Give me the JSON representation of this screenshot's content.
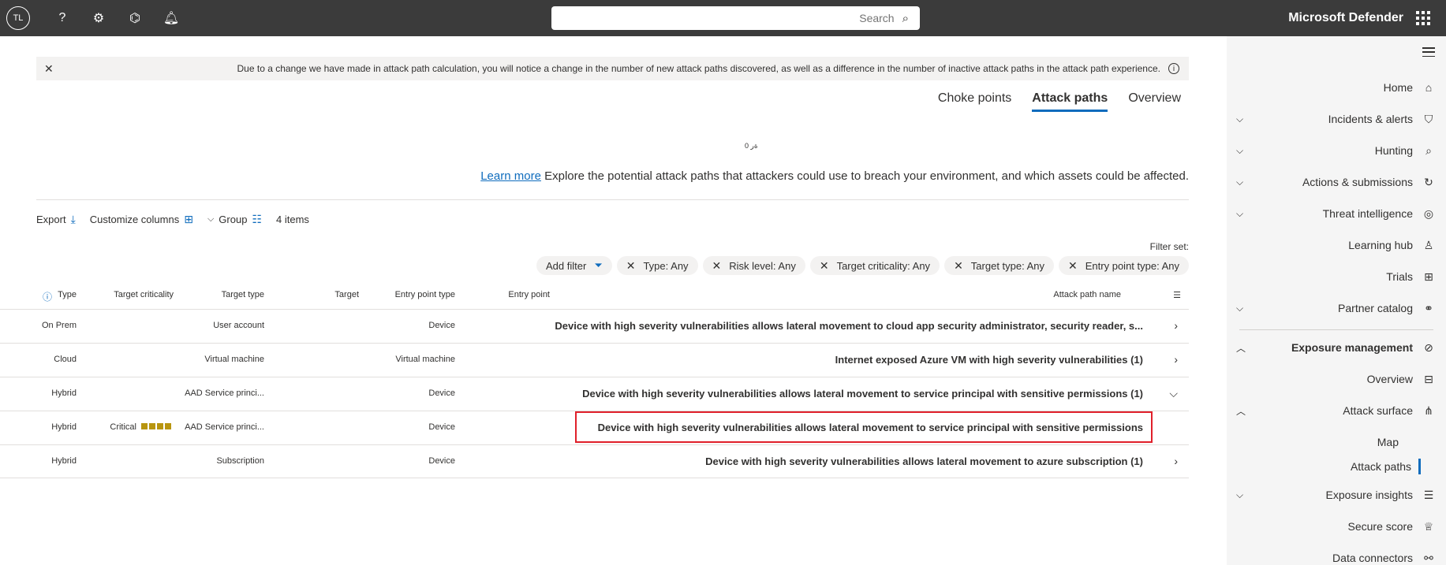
{
  "app": {
    "title": "Microsoft Defender"
  },
  "search": {
    "placeholder": "Search"
  },
  "user": {
    "initials": "TL"
  },
  "banner": {
    "text": "Due to a change we have made in attack path calculation, you will notice a change in the number of new attack paths discovered, as well as a difference in the number of inactive attack paths in the attack path experience."
  },
  "tabs": [
    "Overview",
    "Attack paths",
    "Choke points"
  ],
  "active_tab": "Attack paths",
  "tiny_label": "0 ﻿ﺓﺭ",
  "description": {
    "text": "Explore the potential attack paths that attackers could use to breach your environment, and which assets could be affected.",
    "link": "Learn more"
  },
  "toolbar": {
    "count": "4 items",
    "group": "Group",
    "customize": "Customize columns",
    "export": "Export"
  },
  "filter_set_label": "Filter set:",
  "chips": [
    "Entry point type: Any",
    "Target type: Any",
    "Target criticality: Any",
    "Risk level: Any",
    "Type: Any"
  ],
  "add_filter": "Add filter",
  "columns": {
    "name": "Attack path name",
    "entry_point": "Entry point",
    "entry_point_type": "Entry point type",
    "target": "Target",
    "target_type": "Target type",
    "target_criticality": "Target criticality",
    "type": "Type"
  },
  "rows": [
    {
      "name": "Device with high severity vulnerabilities allows lateral movement to cloud app security administrator, security reader, s...",
      "entry_point_type": "Device",
      "target_type": "User account",
      "target_criticality": "",
      "type": "On Prem"
    },
    {
      "name": "Internet exposed Azure VM with high severity vulnerabilities (1)",
      "entry_point_type": "Virtual machine",
      "target_type": "Virtual machine",
      "target_criticality": "",
      "type": "Cloud"
    },
    {
      "name": "Device with high severity vulnerabilities allows lateral movement to service principal with sensitive permissions (1)",
      "entry_point_type": "Device",
      "target_type": "AAD Service princi...",
      "target_criticality": "",
      "type": "Hybrid"
    },
    {
      "name": "Device with high severity vulnerabilities allows lateral movement to service principal with sensitive permissions",
      "entry_point_type": "Device",
      "target_type": "AAD Service princi...",
      "target_criticality": "Critical",
      "type": "Hybrid"
    },
    {
      "name": "Device with high severity vulnerabilities allows lateral movement to azure subscription (1)",
      "entry_point_type": "Device",
      "target_type": "Subscription",
      "target_criticality": "",
      "type": "Hybrid"
    }
  ],
  "nav": {
    "home": "Home",
    "incidents": "Incidents & alerts",
    "hunting": "Hunting",
    "actions": "Actions & submissions",
    "threat": "Threat intelligence",
    "learning": "Learning hub",
    "trials": "Trials",
    "partner": "Partner catalog",
    "exposure": "Exposure management",
    "overview": "Overview",
    "attack_surface": "Attack surface",
    "map": "Map",
    "attack_paths": "Attack paths",
    "insights": "Exposure insights",
    "secure_score": "Secure score",
    "data_connectors": "Data connectors"
  },
  "colors": {
    "accent": "#0f6cbd",
    "topbar": "#3b3b3b",
    "highlight": "#e0202a",
    "criticality": "#b8950f"
  }
}
